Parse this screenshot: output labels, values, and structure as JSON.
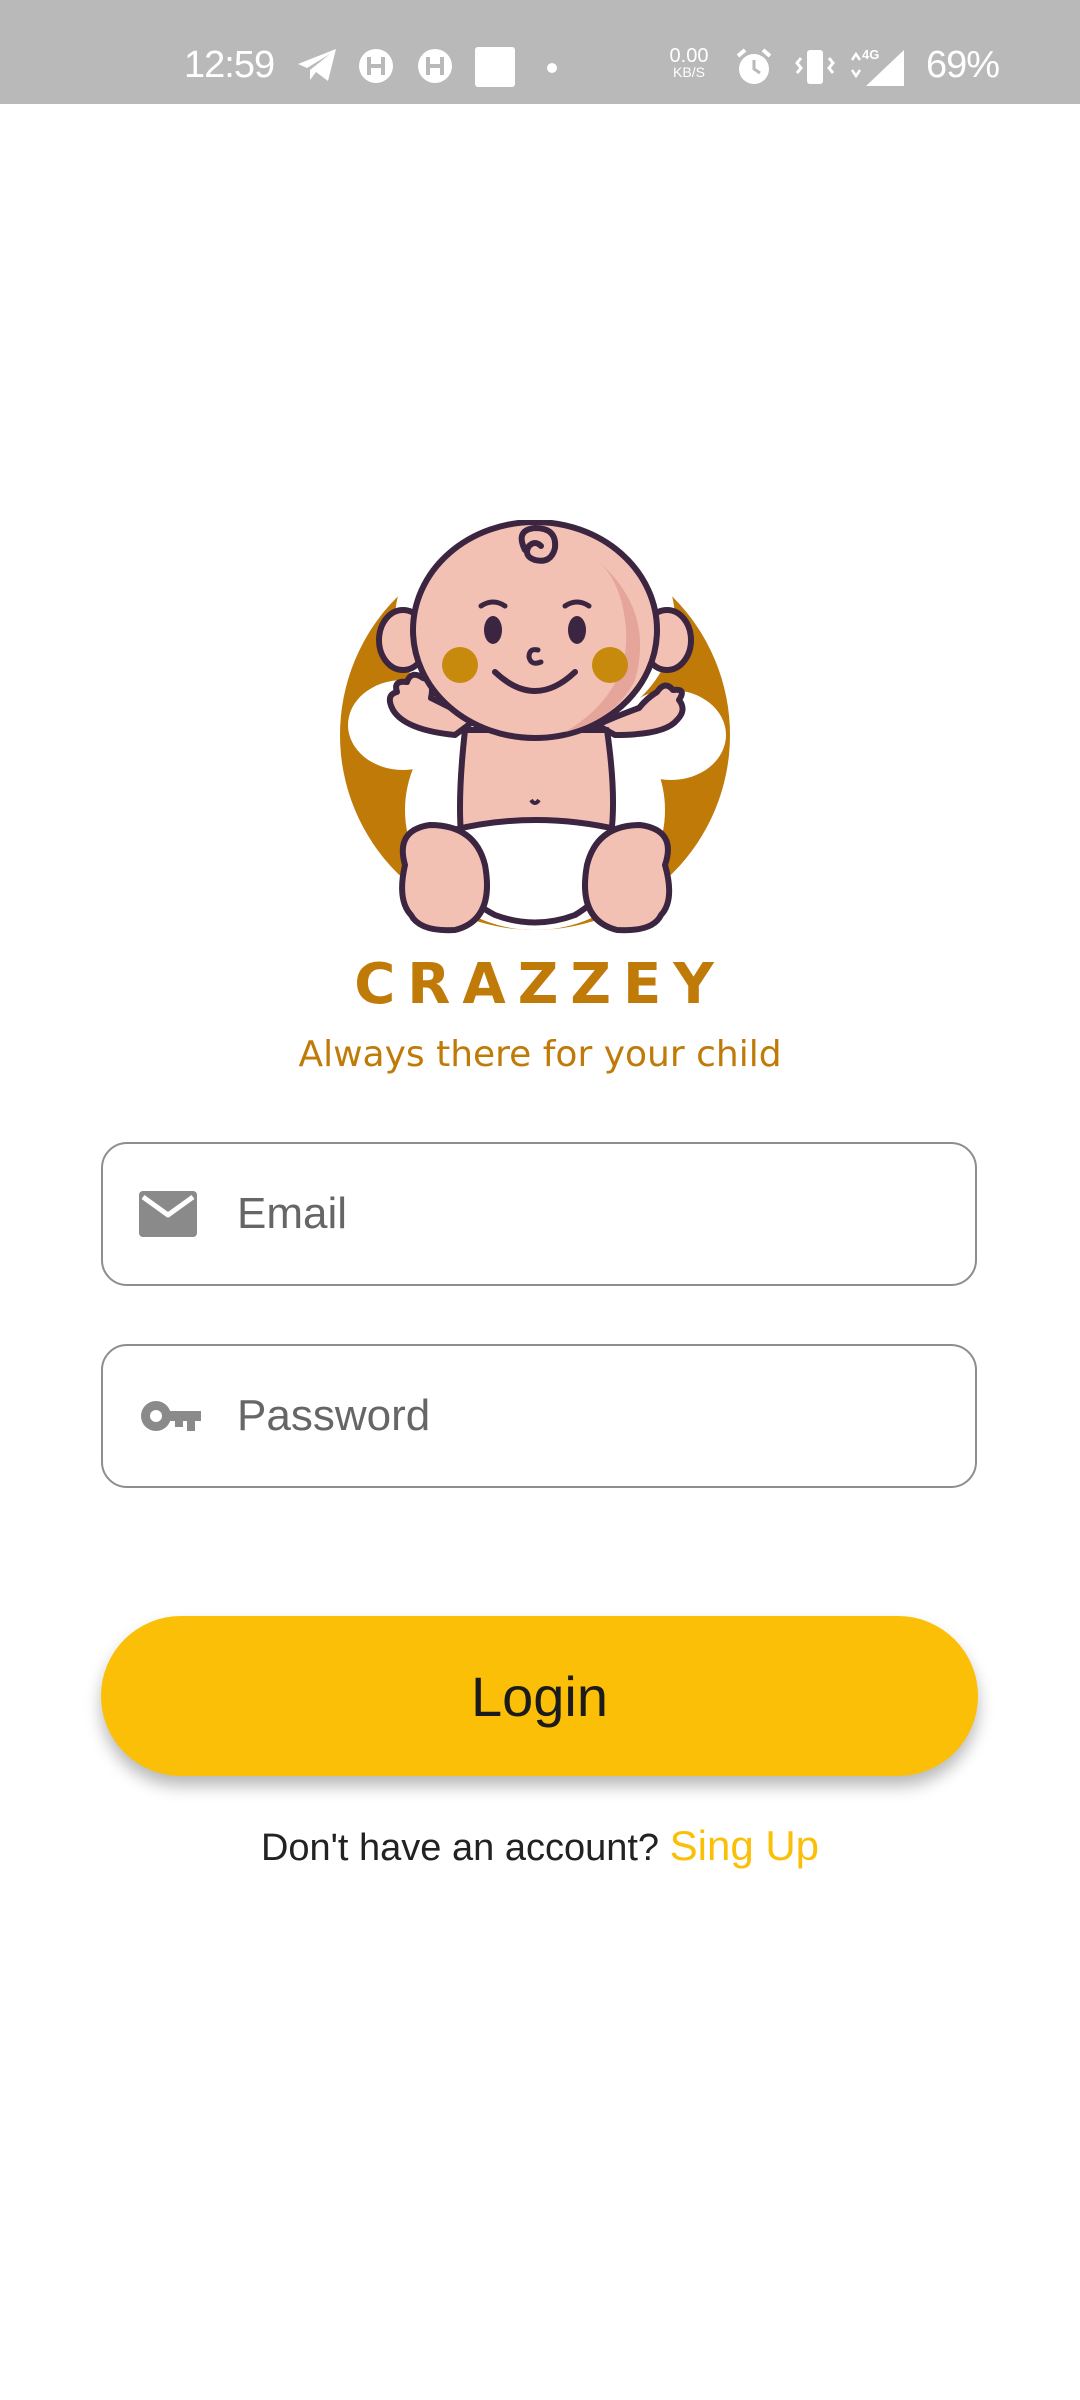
{
  "status_bar": {
    "time": "12:59",
    "network_speed_value": "0.00",
    "network_speed_unit": "KB/S",
    "network_type": "4G",
    "battery": "69%"
  },
  "brand": {
    "name": "CRAZZEY",
    "tagline": "Always there for your child",
    "accent_color": "#c07a08"
  },
  "form": {
    "email": {
      "value": "",
      "placeholder": "Email",
      "icon": "mail-icon"
    },
    "password": {
      "value": "",
      "placeholder": "Password",
      "icon": "key-icon"
    },
    "login_label": "Login",
    "login_color": "#fbbf07"
  },
  "signup": {
    "prompt": "Don't have an account?",
    "link_label": "Sing Up"
  }
}
